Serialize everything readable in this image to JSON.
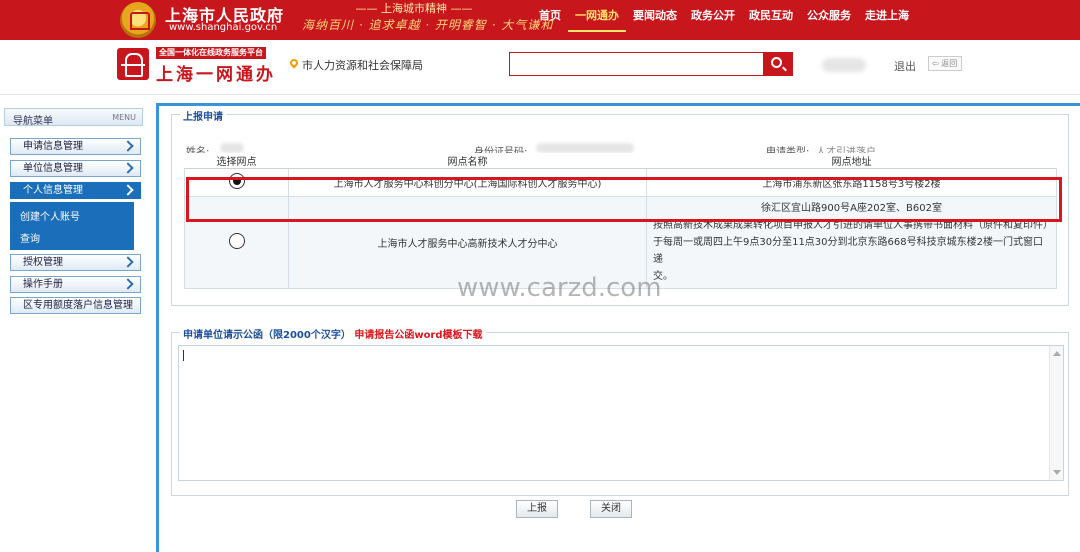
{
  "top": {
    "gov_name": "上海市人民政府",
    "gov_url": "www.shanghai.gov.cn",
    "spirit_title": "—— 上海城市精神 ——",
    "spirit_text": "海纳百川 · 追求卓越 · 开明睿智 · 大气谦和",
    "nav": [
      "首页",
      "一网通办",
      "要闻动态",
      "政务公开",
      "政民互动",
      "公众服务",
      "走进上海"
    ]
  },
  "header": {
    "tagline": "全国一体化在线政务服务平台",
    "brand": "上海一网通办",
    "department": "市人力资源和社会保障局",
    "search_placeholder": "",
    "logout": "退出",
    "back": "⇦ 返回"
  },
  "sidebar": {
    "title": "导航菜单",
    "title_en": "MENU",
    "items": [
      {
        "label": "申请信息管理"
      },
      {
        "label": "单位信息管理"
      },
      {
        "label": "个人信息管理"
      },
      {
        "label": "授权管理"
      },
      {
        "label": "操作手册"
      },
      {
        "label": "区专用额度落户信息管理"
      }
    ],
    "subitems": [
      "创建个人账号",
      "查询"
    ]
  },
  "form": {
    "section_title": "上报申请",
    "name_label": "姓名:",
    "id_label": "身份证号码:",
    "type_label": "申请类型:",
    "type_value": "人才引进落户",
    "columns": [
      "选择网点",
      "网点名称",
      "网点地址"
    ],
    "rows": [
      {
        "name": "上海市人才服务中心科创分中心(上海国际科创人才服务中心)",
        "address": "上海市浦东新区张东路1158号3号楼2楼"
      },
      {
        "name": "上海市人才服务中心高新技术人才分中心",
        "address_line1": "徐汇区宜山路900号A座202室、B602室",
        "address_line2": "按照高新技术成果成果转化项目申报人才引进的请单位人事携带书面材料（原件和复印件）",
        "address_line3": "于每周一或周四上午9点30分至11点30分到北京东路668号科技京城东楼2楼一门式窗口递",
        "address_line4": "交。"
      }
    ],
    "watermark": "www.carzd.com",
    "textarea_title": "申请单位请示公函（限2000个汉字）",
    "download_link": "申请报告公函word模板下载",
    "submit": "上报",
    "close": "关闭"
  }
}
